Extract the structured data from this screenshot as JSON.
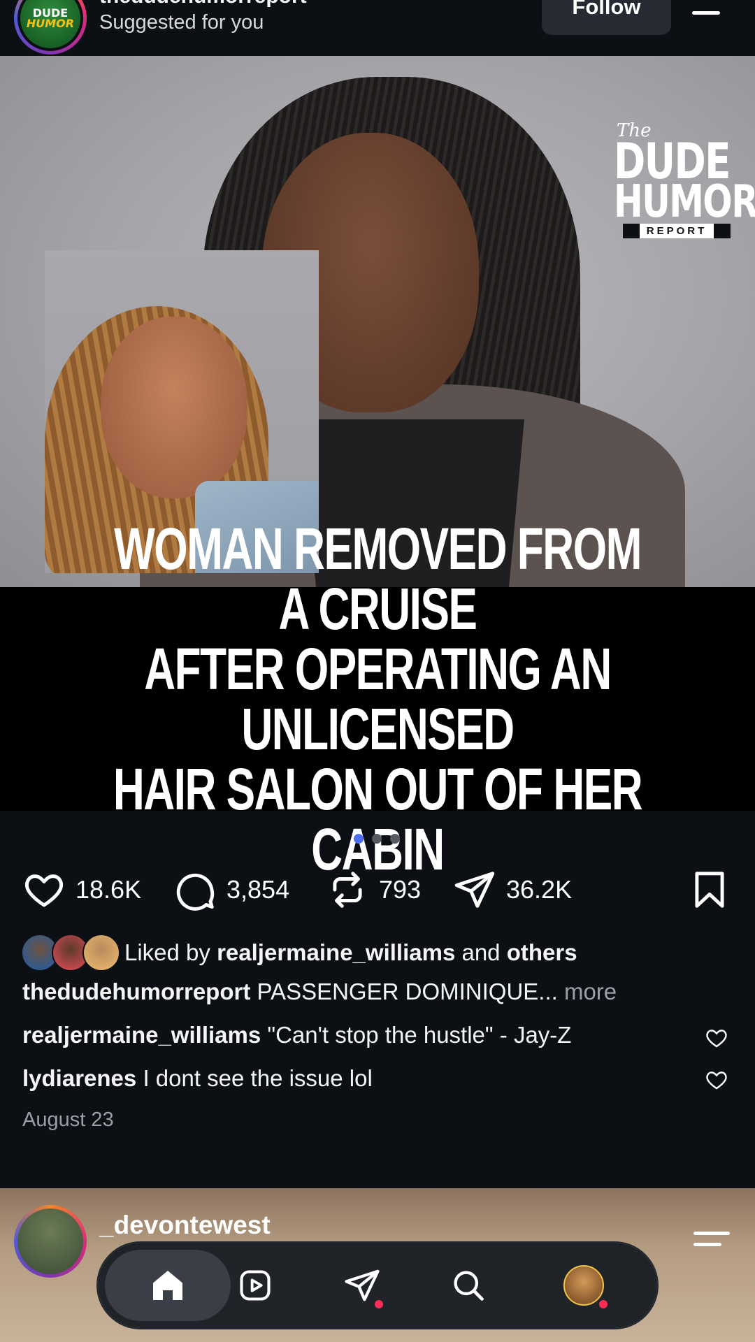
{
  "header": {
    "username": "thedudehumorreport",
    "subtitle": "Suggested for you",
    "follow_label": "Follow",
    "avatar_line1": "DUDE",
    "avatar_line2": "HUMOR"
  },
  "post": {
    "brand_the": "The",
    "brand_line1": "DUDE",
    "brand_line2": "HUMOR",
    "brand_line3": "REPORT",
    "headline": "WOMAN REMOVED FROM A CRUISE\nAFTER OPERATING AN UNLICENSED\nHAIR SALON OUT OF HER CABIN",
    "carousel_total": 3,
    "carousel_active": 1
  },
  "actions": {
    "likes": "18.6K",
    "comments": "3,854",
    "reposts": "793",
    "shares": "36.2K"
  },
  "engagement": {
    "liked_prefix": "Liked by",
    "liked_user": "realjermaine_williams",
    "liked_and": "and",
    "liked_others": "others",
    "caption_user": "thedudehumorreport",
    "caption_text": "PASSENGER DOMINIQUE...",
    "more_label": "more",
    "comments": [
      {
        "user": "realjermaine_williams",
        "text": "\"Can't stop the hustle\" - Jay-Z"
      },
      {
        "user": "lydiarenes",
        "text": "I dont see the issue lol"
      }
    ],
    "date": "August 23"
  },
  "next_post": {
    "username": "_devontewest"
  },
  "colors": {
    "background": "#0c1014",
    "active_dot": "#4c6ef5",
    "notification": "#ff2d55"
  },
  "nav": {
    "items": [
      "home-icon",
      "reels-icon",
      "direct-icon",
      "search-icon",
      "profile-avatar"
    ]
  }
}
